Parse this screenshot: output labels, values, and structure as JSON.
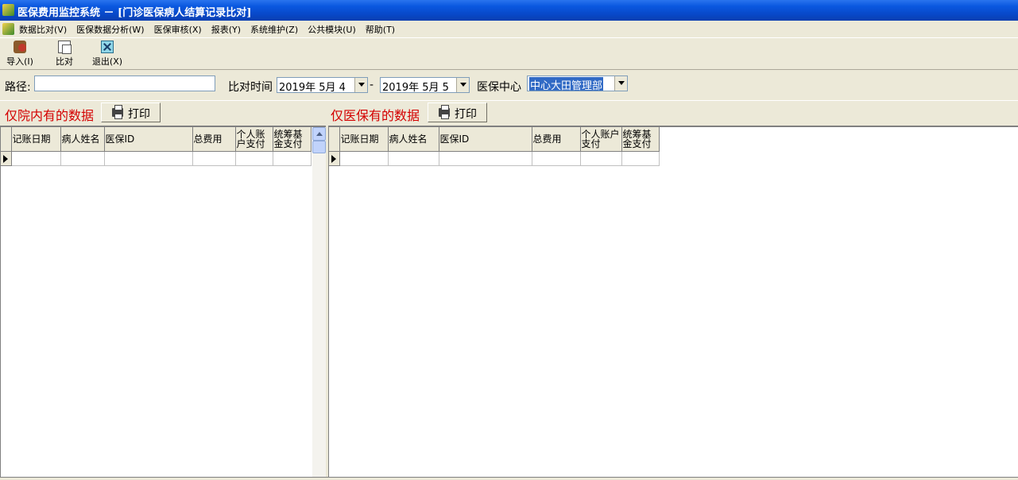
{
  "window": {
    "title": "医保费用监控系统 － [门诊医保病人结算记录比对]"
  },
  "menu": [
    "数据比对(V)",
    "医保数据分析(W)",
    "医保审核(X)",
    "报表(Y)",
    "系统维护(Z)",
    "公共模块(U)",
    "帮助(T)"
  ],
  "toolbar": {
    "import_label": "导入(I)",
    "compare_label": "比对",
    "exit_label": "退出(X)"
  },
  "filter": {
    "path_label": "路径:",
    "path_value": "",
    "time_label": "比对时间",
    "date_from": "2019年  5月  4",
    "dash": "-",
    "date_to": "2019年  5月  5",
    "center_label": "医保中心",
    "center_value": "中心大田管理部"
  },
  "left": {
    "title": "仅院内有的数据",
    "print_label": "打印",
    "columns": [
      "记账日期",
      "病人姓名",
      "医保ID",
      "总费用",
      "个人账户支付",
      "统筹基金支付"
    ]
  },
  "right": {
    "title": "仅医保有的数据",
    "print_label": "打印",
    "columns": [
      "记账日期",
      "病人姓名",
      "医保ID",
      "总费用",
      "个人账户支付",
      "统筹基金支付"
    ]
  }
}
